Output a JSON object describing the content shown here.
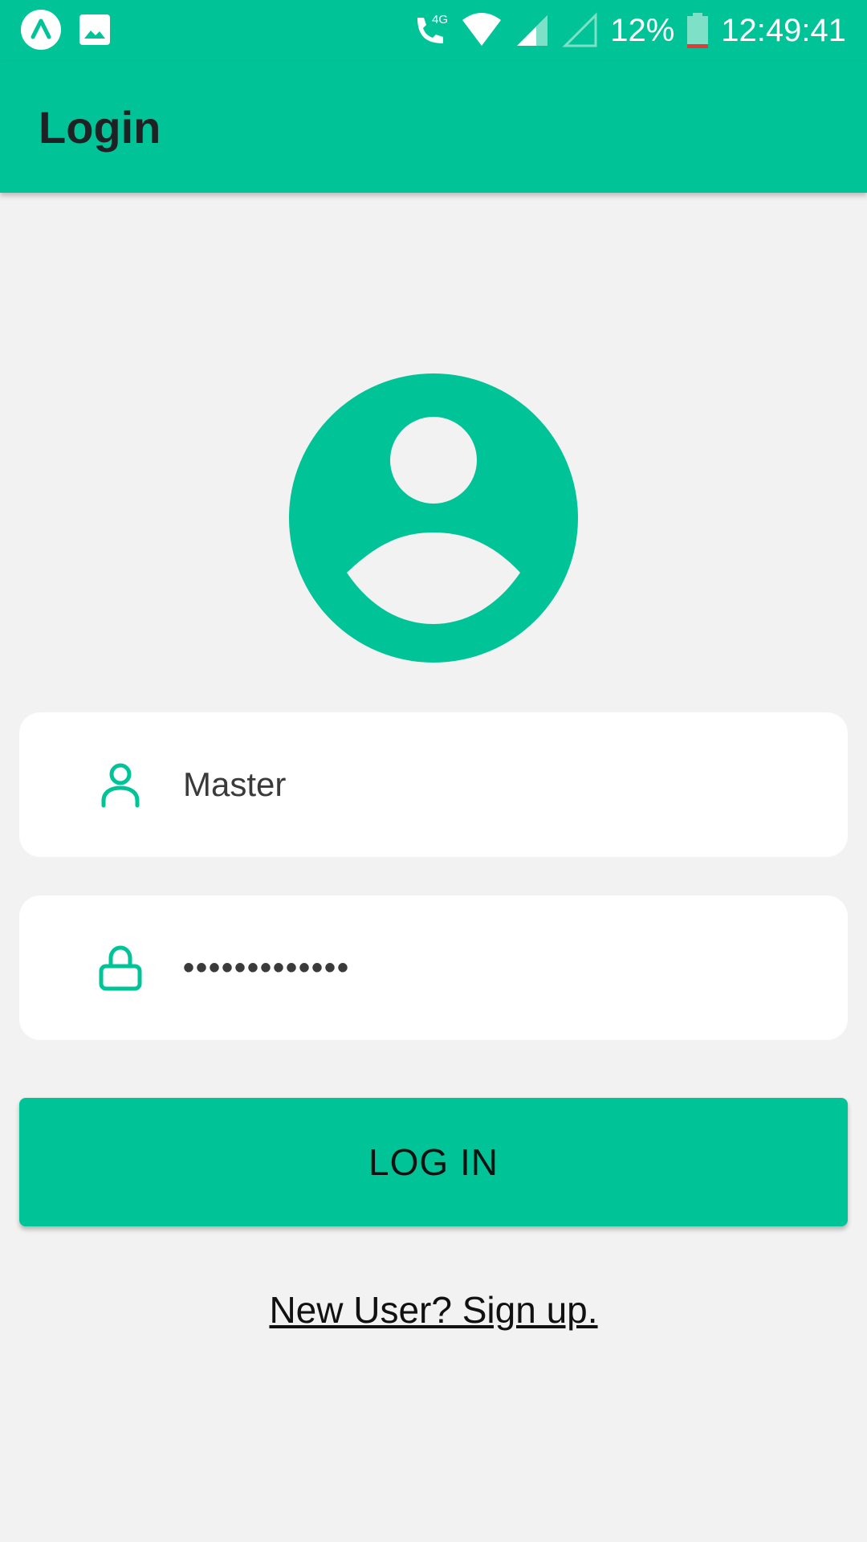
{
  "status_bar": {
    "battery_percent": "12%",
    "time": "12:49:41",
    "network_label": "4G",
    "icons": [
      "app-notification-icon",
      "image-notification-icon",
      "call-4g-icon",
      "wifi-icon",
      "signal-icon",
      "signal-empty-icon",
      "battery-icon"
    ]
  },
  "app_bar": {
    "title": "Login"
  },
  "avatar": {
    "icon": "account-circle-icon"
  },
  "username_field": {
    "icon": "person-outline-icon",
    "value": "Master"
  },
  "password_field": {
    "icon": "lock-outline-icon",
    "value": "•••••••••••••"
  },
  "login_button": {
    "label": "LOG IN"
  },
  "signup_link": {
    "label": "New User? Sign up."
  },
  "colors": {
    "accent": "#00c497",
    "background": "#f2f2f2",
    "field_background": "#ffffff",
    "battery_low": "#e53935"
  }
}
